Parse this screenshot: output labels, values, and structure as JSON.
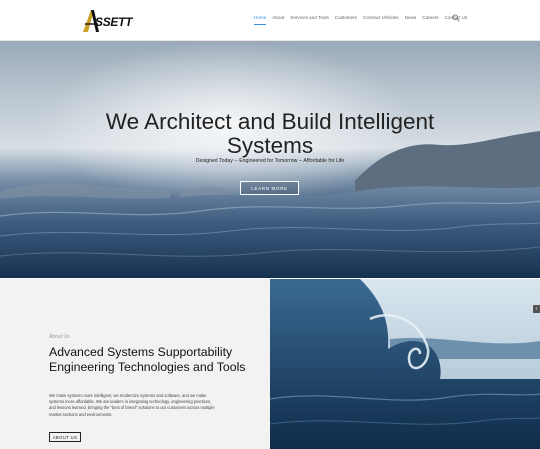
{
  "brand": {
    "logo_text": "SSETT"
  },
  "nav": {
    "items": [
      {
        "label": "Home",
        "active": true
      },
      {
        "label": "About"
      },
      {
        "label": "Services and Tools"
      },
      {
        "label": "Customers"
      },
      {
        "label": "Contract Vehicles"
      },
      {
        "label": "News"
      },
      {
        "label": "Careers"
      },
      {
        "label": "Contact Us"
      }
    ]
  },
  "hero": {
    "title": "We Architect and Build Intelligent Systems",
    "subtitle": "Designed Today -- Engineered for Tomorrow -- Affordable for Life",
    "button_label": "LEARN MORE"
  },
  "about": {
    "kicker": "About Us",
    "title": "Advanced Systems Supportability Engineering Technologies and Tools",
    "body": "We make systems more intelligent, we modernize systems and software, and we make systems more affordable. We are leaders in integrating technology, engineering practices, and lessons learned, bringing the \"best of breed\" solutions to our customers across multiple market sections and environments.",
    "button_label": "ABOUT US"
  },
  "colors": {
    "accent": "#3b8fd6",
    "text_dark": "#222222",
    "about_bg": "#f2f2f2"
  },
  "icons": {
    "search": "search-icon",
    "side_arrow": "chevron-left-icon"
  }
}
